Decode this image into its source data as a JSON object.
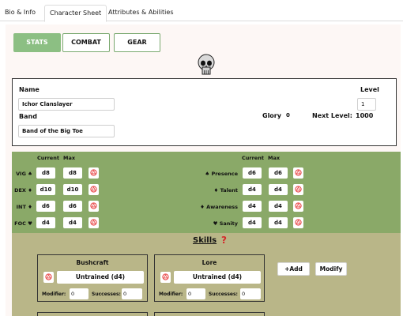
{
  "tabs": [
    "Bio & Info",
    "Character Sheet",
    "Attributes & Abilities"
  ],
  "sheet_tabs": [
    "STATS",
    "COMBAT",
    "GEAR"
  ],
  "identity": {
    "name_label": "Name",
    "name_value": "Ichor Clanslayer",
    "band_label": "Band",
    "band_value": "Band of the Big Toe",
    "level_label": "Level",
    "level_value": "1",
    "glory_label": "Glory",
    "glory_value": "0",
    "next_level_label": "Next Level:",
    "next_level_value": "1000"
  },
  "stats": {
    "current_header": "Current",
    "max_header": "Max",
    "left": [
      {
        "label": "VIG ♠",
        "current": "d8",
        "max": "d8"
      },
      {
        "label": "DEX ♦",
        "current": "d10",
        "max": "d10"
      },
      {
        "label": "INT ♦",
        "current": "d6",
        "max": "d6"
      },
      {
        "label": "FOC ♥",
        "current": "d4",
        "max": "d4"
      }
    ],
    "right": [
      {
        "label": "♠ Presence",
        "current": "d6",
        "max": "d6"
      },
      {
        "label": "♦ Talent",
        "current": "d4",
        "max": "d4"
      },
      {
        "label": "♦ Awareness",
        "current": "d4",
        "max": "d4"
      },
      {
        "label": "♥ Sanity",
        "current": "d4",
        "max": "d4"
      }
    ]
  },
  "skills": {
    "title": "Skills",
    "help": "?",
    "list": [
      {
        "name": "Bushcraft",
        "die": "Untrained (d4)",
        "modifier_label": "Modifier:",
        "modifier": "0",
        "successes_label": "Successes:",
        "successes": "0"
      },
      {
        "name": "Lore",
        "die": "Untrained (d4)",
        "modifier_label": "Modifier:",
        "modifier": "0",
        "successes_label": "Successes:",
        "successes": "0"
      }
    ],
    "add_label": "+Add",
    "modify_label": "Modify"
  },
  "colors": {
    "accent_green": "#8cbf83",
    "stats_bg": "#8aa968",
    "skills_bg": "#b9b688",
    "dice_icon_red": "#e84545"
  },
  "icons": [
    "skull-icon",
    "dice-roll-icon",
    "help-icon"
  ]
}
